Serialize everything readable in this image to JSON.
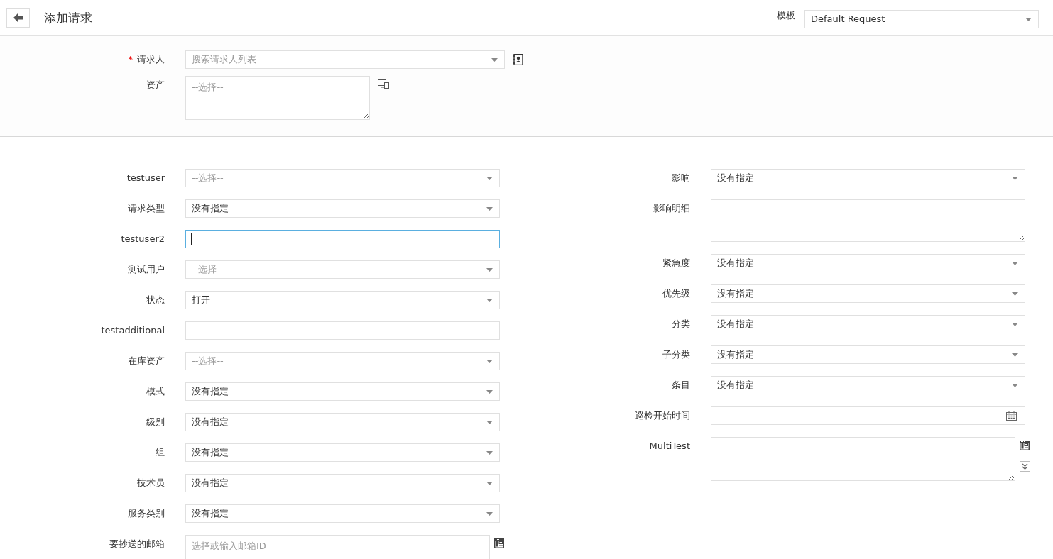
{
  "header": {
    "title": "添加请求",
    "template_label": "模板",
    "template_value": "Default Request"
  },
  "requester_section": [
    {
      "label": "请求人",
      "required_mark": "*",
      "kind": "select",
      "placeholder": "搜索请求人列表",
      "icons": [
        {
          "kind": "contacts"
        }
      ]
    },
    {
      "label": "资产",
      "kind": "textarea",
      "placeholder": "--选择--",
      "icons": [
        {
          "kind": "devices"
        }
      ]
    }
  ],
  "left_fields": [
    {
      "label": "testuser",
      "kind": "select",
      "placeholder": "--选择--"
    },
    {
      "label": "请求类型",
      "kind": "select",
      "value": "没有指定"
    },
    {
      "label": "testuser2",
      "kind": "text",
      "focused": true
    },
    {
      "label": "测试用户",
      "kind": "select",
      "placeholder": "--选择--"
    },
    {
      "label": "状态",
      "kind": "select",
      "value": "打开"
    },
    {
      "label": "testadditional",
      "kind": "text",
      "focused": false
    },
    {
      "label": "在库资产",
      "kind": "select",
      "placeholder": "--选择--"
    },
    {
      "label": "模式",
      "kind": "select",
      "value": "没有指定"
    },
    {
      "label": "级别",
      "kind": "select",
      "value": "没有指定"
    },
    {
      "label": "组",
      "kind": "select",
      "value": "没有指定"
    },
    {
      "label": "技术员",
      "kind": "select",
      "value": "没有指定"
    },
    {
      "label": "服务类别",
      "kind": "select",
      "value": "没有指定"
    },
    {
      "label": "要抄送的邮箱",
      "kind": "textarea",
      "placeholder": "选择或输入邮箱ID",
      "icons": [
        {
          "kind": "panel"
        }
      ]
    }
  ],
  "right_fields": [
    {
      "label": "影响",
      "kind": "select",
      "value": "没有指定"
    },
    {
      "label": "影响明细",
      "kind": "textarea"
    },
    {
      "label": "紧急度",
      "kind": "select",
      "value": "没有指定"
    },
    {
      "label": "优先级",
      "kind": "select",
      "value": "没有指定"
    },
    {
      "label": "分类",
      "kind": "select",
      "value": "没有指定"
    },
    {
      "label": "子分类",
      "kind": "select",
      "value": "没有指定"
    },
    {
      "label": "条目",
      "kind": "select",
      "value": "没有指定"
    },
    {
      "label": "巡检开始时间",
      "kind": "date"
    },
    {
      "label": "MultiTest",
      "kind": "textarea",
      "icons": [
        {
          "kind": "panel"
        },
        {
          "kind": "expand"
        }
      ]
    }
  ]
}
